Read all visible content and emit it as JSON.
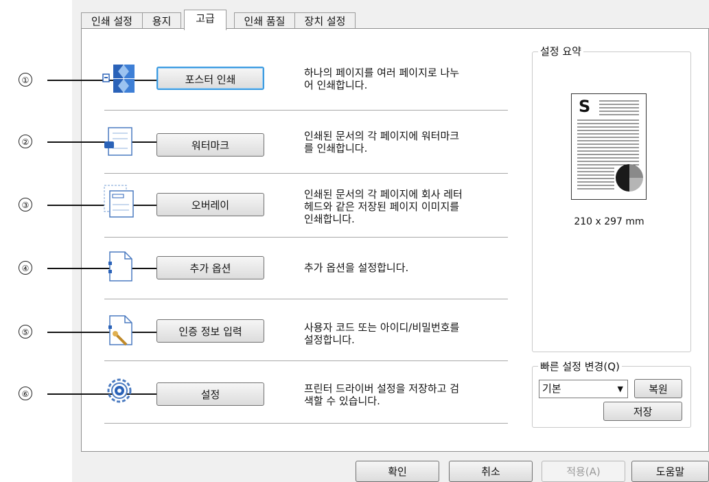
{
  "tabs": [
    "인쇄 설정",
    "용지",
    "고급",
    "인쇄 품질",
    "장치 설정"
  ],
  "active_tab": "고급",
  "features": [
    {
      "num": "①",
      "button": "포스터 인쇄",
      "desc": "하나의 페이지를 여러 페이지로 나누\n어 인쇄합니다.",
      "icon": "poster-icon"
    },
    {
      "num": "②",
      "button": "워터마크",
      "desc": "인쇄된 문서의 각 페이지에 워터마크\n를 인쇄합니다.",
      "icon": "watermark-icon"
    },
    {
      "num": "③",
      "button": "오버레이",
      "desc": "인쇄된 문서의 각 페이지에 회사 레터\n헤드와 같은 저장된 페이지 이미지를\n인쇄합니다.",
      "icon": "overlay-icon"
    },
    {
      "num": "④",
      "button": "추가 옵션",
      "desc": "추가 옵션을 설정합니다.",
      "icon": "additional-options-icon"
    },
    {
      "num": "⑤",
      "button": "인증 정보 입력",
      "desc": "사용자 코드 또는 아이디/비밀번호를\n설정합니다.",
      "icon": "authentication-icon"
    },
    {
      "num": "⑥",
      "button": "설정",
      "desc": "프린터 드라이버 설정을 저장하고 검\n색할 수 있습니다.",
      "icon": "gear-icon"
    }
  ],
  "summary": {
    "title": "설정 요약",
    "preview_letter": "S",
    "paper_size": "210 x 297 mm"
  },
  "quick_settings": {
    "title": "빠른 설정 변경(Q)",
    "selected": "기본",
    "restore_label": "복원",
    "save_label": "저장"
  },
  "footer": {
    "ok": "확인",
    "cancel": "취소",
    "apply": "적용(A)",
    "help": "도움말"
  }
}
